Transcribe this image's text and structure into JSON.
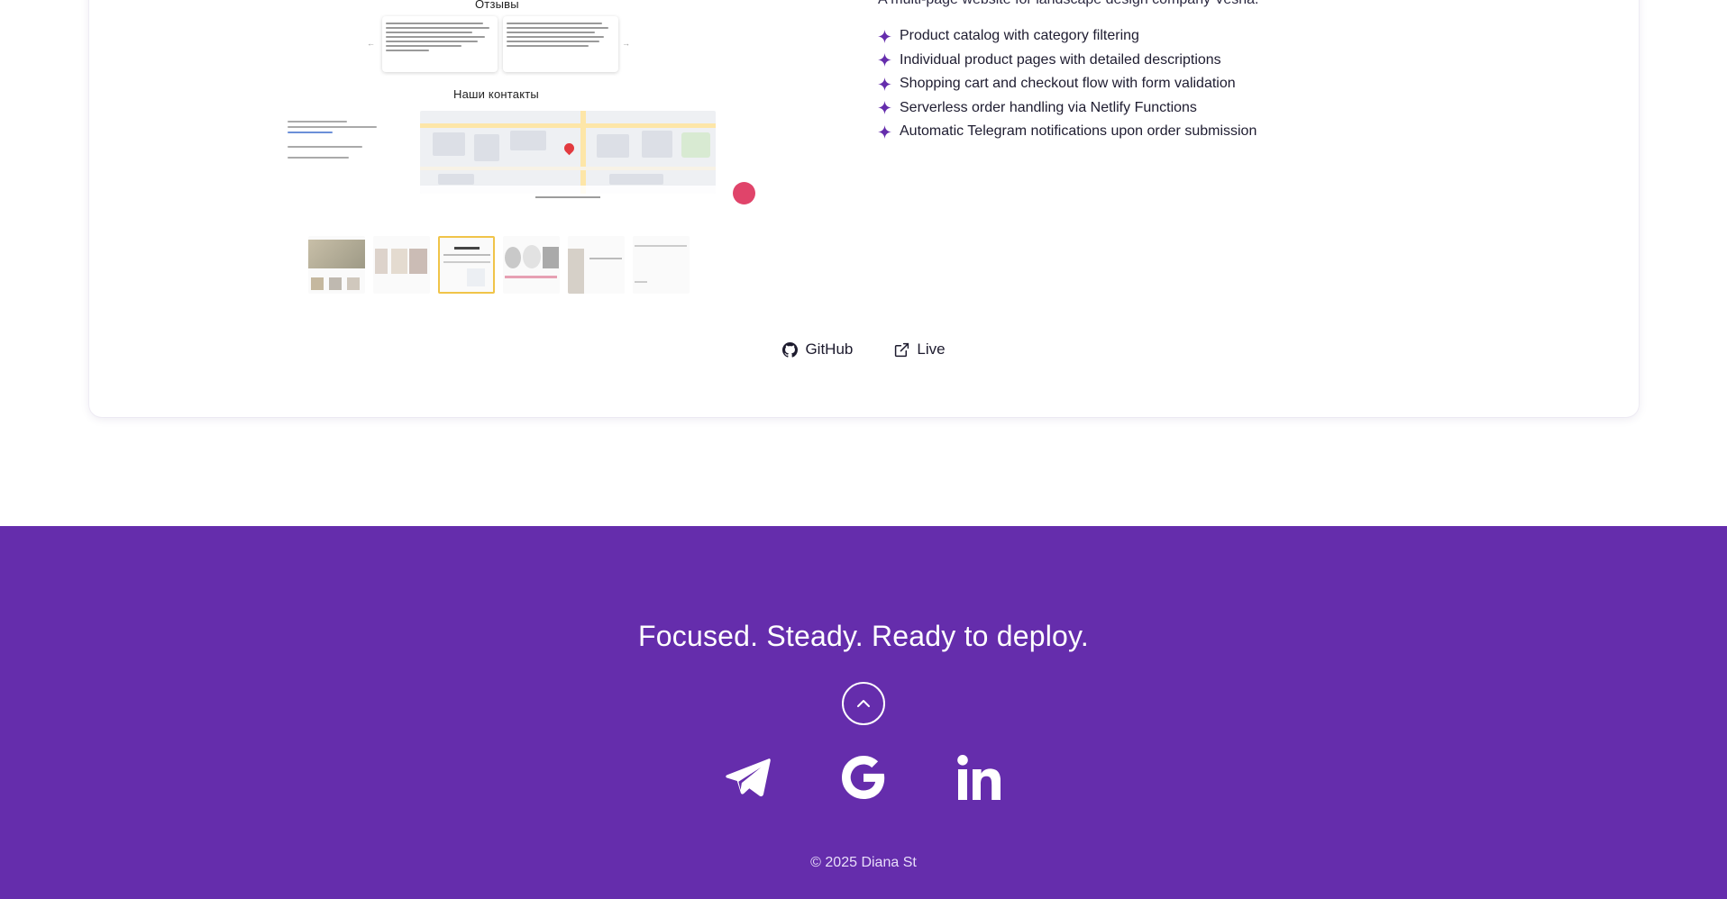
{
  "project": {
    "description": "A multi-page website for landscape design company Vesna.",
    "features": [
      "Product catalog with category filtering",
      "Individual product pages with detailed descriptions",
      "Shopping cart and checkout flow with form validation",
      "Serverless order handling via Netlify Functions",
      "Automatic Telegram notifications upon order submission"
    ],
    "preview": {
      "reviews_heading": "Отзывы",
      "contacts_heading": "Наши контакты"
    },
    "links": {
      "github_label": "GitHub",
      "live_label": "Live"
    },
    "accent_color": "#652dac"
  },
  "footer": {
    "tagline": "Focused. Steady. Ready to deploy.",
    "scroll_top_icon": "chevron-up-icon",
    "socials": [
      {
        "name": "telegram-icon"
      },
      {
        "name": "google-icon"
      },
      {
        "name": "linkedin-icon"
      }
    ],
    "copyright": "© 2025 Diana St",
    "background_color": "#652dac"
  }
}
